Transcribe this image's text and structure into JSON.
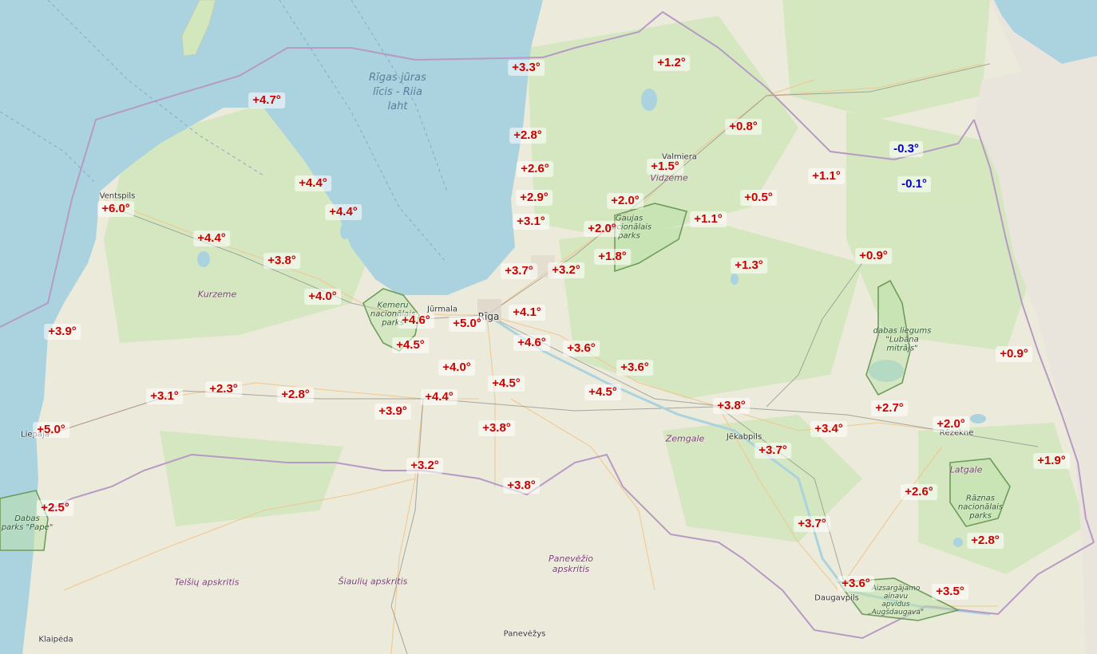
{
  "colors": {
    "sea": "#aad3df",
    "land": "#f2efe9",
    "forest": "#cfe6b8",
    "positive": "#cc0000",
    "negative": "#0000cc",
    "border": "#b79ac4",
    "park_border": "#6d9c5a"
  },
  "sea_label": "Rīgas jūras\nlīcis - Riia\nlaht",
  "places": [
    {
      "name": "Ventspils"
    },
    {
      "name": "Jūrmala"
    },
    {
      "name": "Rīga"
    },
    {
      "name": "Valmiera"
    },
    {
      "name": "Liepāja"
    },
    {
      "name": "Jēkabpils"
    },
    {
      "name": "Rēzekne"
    },
    {
      "name": "Daugavpils"
    },
    {
      "name": "Klaipėda"
    },
    {
      "name": "Panevėžys"
    }
  ],
  "regions": [
    {
      "name": "Kurzeme"
    },
    {
      "name": "Vidzeme"
    },
    {
      "name": "Zemgale"
    },
    {
      "name": "Latgale"
    },
    {
      "name": "Telšių apskritis"
    },
    {
      "name": "Šiaulių apskritis"
    },
    {
      "name": "Panevėžio\napskritis"
    }
  ],
  "parks": [
    {
      "name": "Ķemeru\nnacionālais\nparks"
    },
    {
      "name": "Gaujas\nnacionālais\nparks"
    },
    {
      "name": "dabas liegums\n\"Lubāna\nmitrājs\""
    },
    {
      "name": "Rāznas\nnacionālais\nparks"
    },
    {
      "name": "Dabas\nparks \"Pape\""
    },
    {
      "name": "Aizsargājamo\nainavu\napvidus\n„Augšdaugava\""
    }
  ],
  "temperatures": [
    {
      "value": "+3.3°"
    },
    {
      "value": "+1.2°"
    },
    {
      "value": "+4.7°"
    },
    {
      "value": "+0.8°"
    },
    {
      "value": "+2.8°"
    },
    {
      "value": "-0.3°"
    },
    {
      "value": "+2.6°"
    },
    {
      "value": "+1.5°"
    },
    {
      "value": "+1.1°"
    },
    {
      "value": "+4.4°"
    },
    {
      "value": "-0.1°"
    },
    {
      "value": "+2.9°"
    },
    {
      "value": "+2.0°"
    },
    {
      "value": "+0.5°"
    },
    {
      "value": "+6.0°"
    },
    {
      "value": "+4.4°"
    },
    {
      "value": "+3.1°"
    },
    {
      "value": "+1.1°"
    },
    {
      "value": "+2.0°"
    },
    {
      "value": "+4.4°"
    },
    {
      "value": "+1.8°"
    },
    {
      "value": "+0.9°"
    },
    {
      "value": "+3.8°"
    },
    {
      "value": "+1.3°"
    },
    {
      "value": "+3.7°"
    },
    {
      "value": "+3.2°"
    },
    {
      "value": "+4.0°"
    },
    {
      "value": "+4.1°"
    },
    {
      "value": "+4.6°"
    },
    {
      "value": "+5.0°"
    },
    {
      "value": "+3.9°"
    },
    {
      "value": "+4.5°"
    },
    {
      "value": "+4.6°"
    },
    {
      "value": "+3.6°"
    },
    {
      "value": "+0.9°"
    },
    {
      "value": "+3.6°"
    },
    {
      "value": "+4.0°"
    },
    {
      "value": "+4.5°"
    },
    {
      "value": "+4.5°"
    },
    {
      "value": "+3.1°"
    },
    {
      "value": "+2.3°"
    },
    {
      "value": "+2.8°"
    },
    {
      "value": "+4.4°"
    },
    {
      "value": "+3.8°"
    },
    {
      "value": "+3.9°"
    },
    {
      "value": "+2.7°"
    },
    {
      "value": "+5.0°"
    },
    {
      "value": "+3.8°"
    },
    {
      "value": "+3.4°"
    },
    {
      "value": "+2.0°"
    },
    {
      "value": "+3.7°"
    },
    {
      "value": "+1.9°"
    },
    {
      "value": "+3.2°"
    },
    {
      "value": "+3.8°"
    },
    {
      "value": "+2.6°"
    },
    {
      "value": "+2.5°"
    },
    {
      "value": "+3.7°"
    },
    {
      "value": "+2.8°"
    },
    {
      "value": "+3.6°"
    },
    {
      "value": "+3.5°"
    }
  ]
}
